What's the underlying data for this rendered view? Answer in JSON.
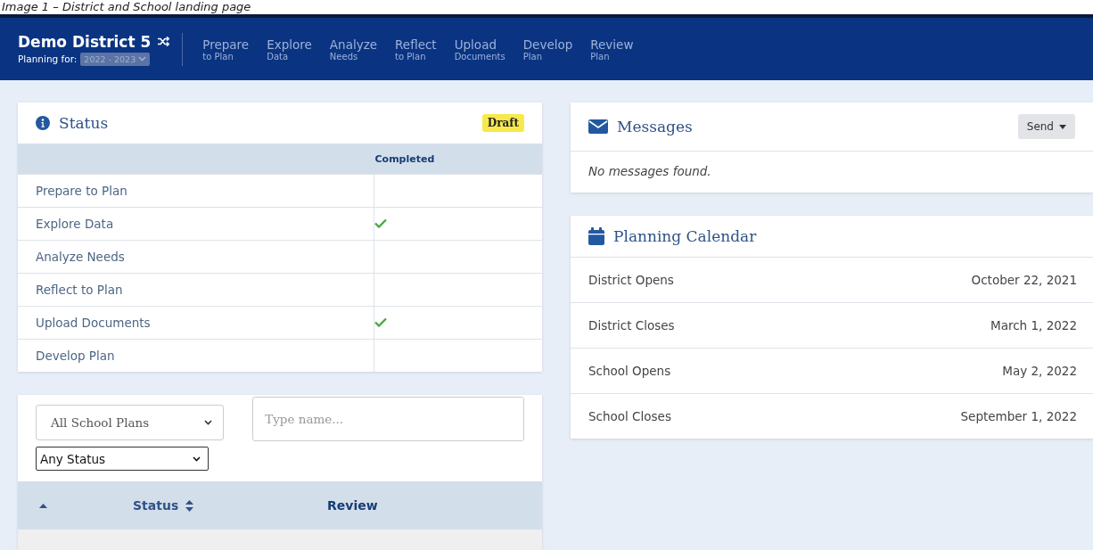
{
  "caption": "Image 1 – District and School landing page",
  "navbar": {
    "title": "Demo District 5",
    "planning_label": "Planning for:",
    "year": "2022 - 2023",
    "items": [
      {
        "top": "Prepare",
        "bottom": "to Plan"
      },
      {
        "top": "Explore",
        "bottom": "Data"
      },
      {
        "top": "Analyze",
        "bottom": "Needs"
      },
      {
        "top": "Reflect",
        "bottom": "to Plan"
      },
      {
        "top": "Upload",
        "bottom": "Documents"
      },
      {
        "top": "Develop",
        "bottom": "Plan"
      },
      {
        "top": "Review",
        "bottom": "Plan"
      }
    ]
  },
  "status": {
    "title": "Status",
    "badge": "Draft",
    "column": "Completed",
    "rows": [
      {
        "label": "Prepare to Plan",
        "completed": false
      },
      {
        "label": "Explore Data",
        "completed": true
      },
      {
        "label": "Analyze Needs",
        "completed": false
      },
      {
        "label": "Reflect to Plan",
        "completed": false
      },
      {
        "label": "Upload Documents",
        "completed": true
      },
      {
        "label": "Develop Plan",
        "completed": false
      }
    ]
  },
  "plans": {
    "plan_filter": "All School Plans",
    "name_placeholder": "Type name...",
    "status_filter": "Any Status",
    "columns": [
      {
        "label": "Status",
        "sortable": true
      },
      {
        "label": "Review",
        "sortable": false
      }
    ]
  },
  "messages": {
    "title": "Messages",
    "send": "Send",
    "empty": "No messages found."
  },
  "calendar": {
    "title": "Planning Calendar",
    "rows": [
      {
        "event": "District Opens",
        "date": "October 22, 2021"
      },
      {
        "event": "District Closes",
        "date": "March 1, 2022"
      },
      {
        "event": "School Opens",
        "date": "May 2, 2022"
      },
      {
        "event": "School Closes",
        "date": "September 1, 2022"
      }
    ]
  }
}
